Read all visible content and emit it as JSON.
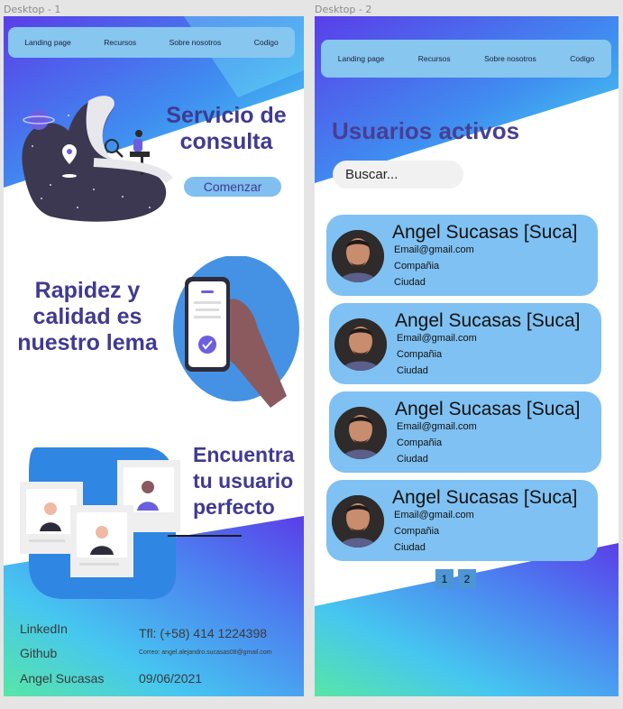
{
  "frames": [
    {
      "label": "Desktop - 1",
      "nav": [
        "Landing page",
        "Recursos",
        "Sobre nosotros",
        "Codigo"
      ],
      "hero": {
        "title": "Servicio de consulta",
        "cta": "Comenzar"
      },
      "section2": {
        "title": "Rapidez y calidad es nuestro lema"
      },
      "section3": {
        "title": "Encuentra tu usuario perfecto"
      },
      "footer": {
        "links": [
          "LinkedIn",
          "Github",
          "Angel Sucasas"
        ],
        "phone": "Tfl: (+58) 414 1224398",
        "email": "Correo: angel.alejandro.sucasas08@gmail.com",
        "date": "09/06/2021"
      }
    },
    {
      "label": "Desktop - 2",
      "nav": [
        "Landing page",
        "Recursos",
        "Sobre nosotros",
        "Codigo"
      ],
      "title": "Usuarios activos",
      "search_placeholder": "Buscar...",
      "users": [
        {
          "name": "Angel Sucasas [Suca]",
          "email": "Email@gmail.com",
          "company": "Compañia",
          "city": "Ciudad"
        },
        {
          "name": "Angel Sucasas [Suca]",
          "email": "Email@gmail.com",
          "company": "Compañia",
          "city": "Ciudad"
        },
        {
          "name": "Angel Sucasas [Suca]",
          "email": "Email@gmail.com",
          "company": "Compañia",
          "city": "Ciudad"
        },
        {
          "name": "Angel Sucasas [Suca]",
          "email": "Email@gmail.com",
          "company": "Compañia",
          "city": "Ciudad"
        }
      ],
      "pages": [
        "1",
        "2"
      ]
    }
  ],
  "colors": {
    "accent": "#473e94",
    "nav": "#86c6ef",
    "card": "#7fc1f2",
    "pager": "#4c96d6"
  }
}
